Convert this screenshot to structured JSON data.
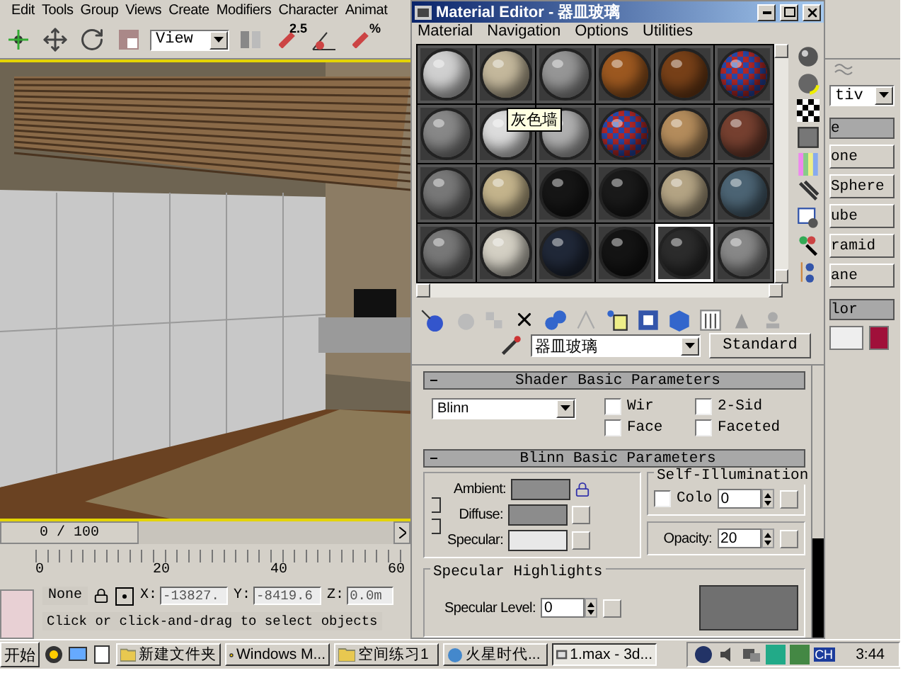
{
  "app": {
    "menu": [
      "Edit",
      "Tools",
      "Group",
      "Views",
      "Create",
      "Modifiers",
      "Character",
      "Animat"
    ],
    "toolbar": {
      "view_dropdown": "View",
      "snap_label": "2.5",
      "percent_label": "%"
    },
    "time_slider": {
      "label": "0 / 100",
      "level": 0
    },
    "track_ticks": [
      "0",
      "20",
      "40",
      "60"
    ],
    "status": {
      "selection": "None",
      "coords": [
        {
          "label": "X:",
          "value": "-13827."
        },
        {
          "label": "Y:",
          "value": "-8419.6"
        },
        {
          "label": "Z:",
          "value": "0.0m"
        }
      ],
      "prompt": "Click or click-and-drag to select objects"
    },
    "command_panel": {
      "dropdown": "tiv",
      "rollouts": [
        {
          "title": "e",
          "buttons": [
            "one",
            "Sphere",
            "ube",
            "ramid",
            "ane"
          ]
        },
        {
          "title": "lor"
        }
      ]
    }
  },
  "material_editor": {
    "title": "Material Editor - 器皿玻璃",
    "menu": [
      "Material",
      "Navigation",
      "Options",
      "Utilities"
    ],
    "slots": [
      {
        "kind": "sphere",
        "color": "#d0d0d0",
        "selected": false
      },
      {
        "kind": "sphere",
        "color": "#c4b89c",
        "selected": false
      },
      {
        "kind": "sphere",
        "color": "#969696",
        "selected": false
      },
      {
        "kind": "sphere",
        "color": "#9c5820",
        "selected": false
      },
      {
        "kind": "sphere",
        "color": "#774018",
        "selected": false
      },
      {
        "kind": "checker",
        "selected": false
      },
      {
        "kind": "sphere",
        "color": "#888888",
        "selected": false
      },
      {
        "kind": "sphere",
        "color": "#dcdcdc",
        "selected": false
      },
      {
        "kind": "sphere",
        "color": "#b0b0b0",
        "selected": false
      },
      {
        "kind": "checker",
        "selected": false
      },
      {
        "kind": "sphere",
        "color": "#b48c5c",
        "selected": false
      },
      {
        "kind": "sphere",
        "color": "#764030",
        "selected": false
      },
      {
        "kind": "sphere",
        "color": "#787878",
        "selected": false
      },
      {
        "kind": "sphere",
        "color": "#c4b48c",
        "selected": false
      },
      {
        "kind": "sphere",
        "color": "#161616",
        "selected": false
      },
      {
        "kind": "sphere",
        "color": "#1a1a1a",
        "selected": false
      },
      {
        "kind": "sphere",
        "color": "#b4a484",
        "selected": false
      },
      {
        "kind": "sphere",
        "color": "#4c6474",
        "selected": false
      },
      {
        "kind": "sphere",
        "color": "#787878",
        "selected": false
      },
      {
        "kind": "sphere",
        "color": "#d4d0c4",
        "selected": false
      },
      {
        "kind": "sphere",
        "color": "#202838",
        "selected": false
      },
      {
        "kind": "sphere",
        "color": "#141414",
        "selected": false
      },
      {
        "kind": "sphere",
        "color": "#2c2c2c",
        "selected": true
      },
      {
        "kind": "sphere",
        "color": "#888888",
        "selected": false
      }
    ],
    "tooltip": "灰色墙",
    "material_name": "器皿玻璃",
    "material_type": "Standard",
    "shader_rollout": {
      "title": "Shader Basic Parameters",
      "shader": "Blinn",
      "options": [
        {
          "label": "Wir",
          "checked": false
        },
        {
          "label": "2-Sid",
          "checked": false
        },
        {
          "label": "Face",
          "checked": false
        },
        {
          "label": "Faceted",
          "checked": false
        }
      ]
    },
    "basic_rollout": {
      "title": "Blinn Basic Parameters",
      "colors": [
        {
          "label": "Ambient:",
          "color": "#8c8c8c"
        },
        {
          "label": "Diffuse:",
          "color": "#8c8c8c"
        },
        {
          "label": "Specular:",
          "color": "#e8e8e8"
        }
      ],
      "self_illumination": {
        "title": "Self-Illumination",
        "label": "Colo",
        "checked": false,
        "value": "0"
      },
      "opacity": {
        "label": "Opacity:",
        "value": "20"
      },
      "specular": {
        "title": "Specular Highlights",
        "level_label": "Specular Level:",
        "level_value": "0"
      }
    }
  },
  "taskbar": {
    "start": "开始",
    "tasks": [
      {
        "kind": "folder",
        "label": "新建文件夹",
        "selected": false
      },
      {
        "kind": "media",
        "label": "Windows M...",
        "selected": false
      },
      {
        "kind": "folder",
        "label": "空间练习1",
        "selected": false
      },
      {
        "kind": "browser",
        "label": "火星时代...",
        "selected": false
      },
      {
        "kind": "app",
        "label": "1.max - 3d...",
        "selected": true
      }
    ],
    "language": "CH",
    "clock": "3:44"
  }
}
